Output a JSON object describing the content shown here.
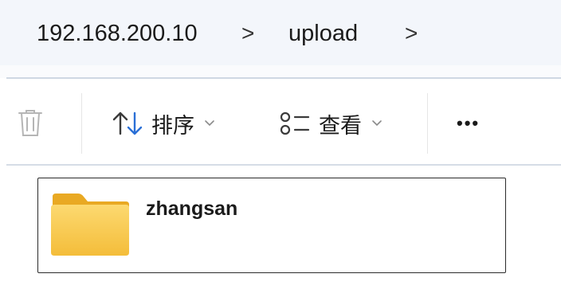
{
  "breadcrumb": {
    "items": [
      {
        "label": "192.168.200.10"
      },
      {
        "label": "upload"
      }
    ],
    "separator": ">"
  },
  "toolbar": {
    "delete_icon": "trash-icon",
    "sort_label": "排序",
    "view_label": "查看",
    "more_label": "•••"
  },
  "files": [
    {
      "name": "zhangsan",
      "icon": "folder-icon"
    }
  ],
  "colors": {
    "address_bg": "#f3f6fb",
    "folder_yellow": "#f7c94b",
    "sort_arrow_blue": "#2a6fd6"
  }
}
